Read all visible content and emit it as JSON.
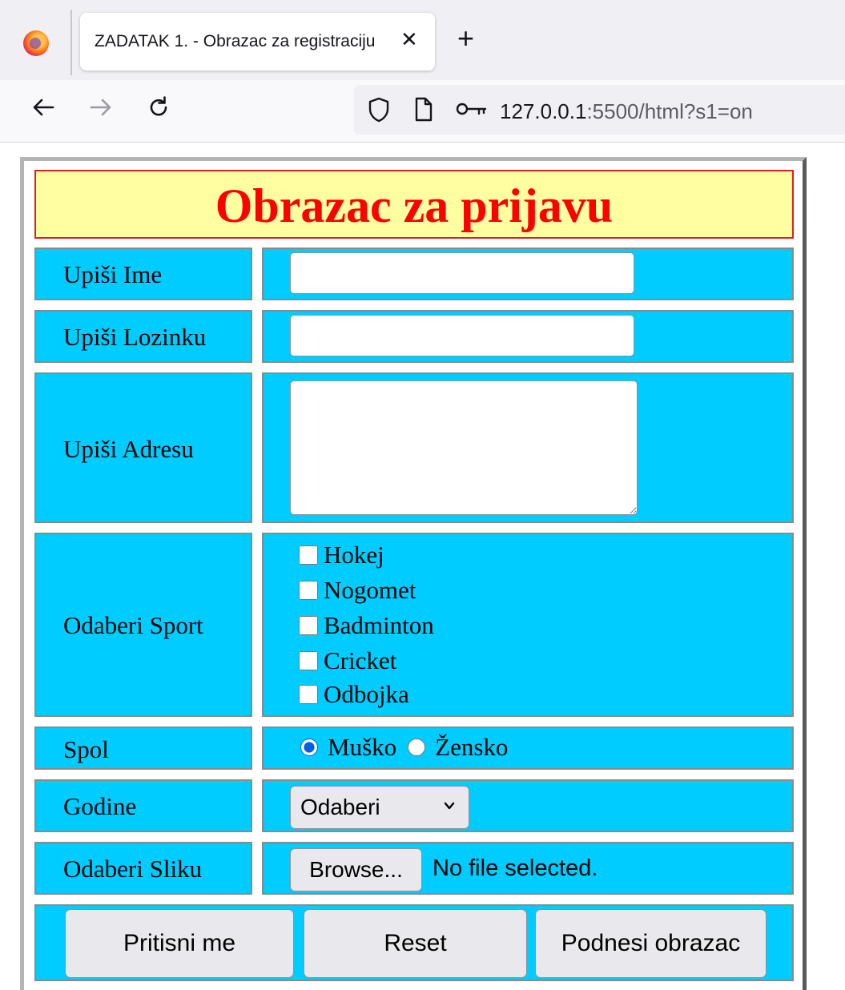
{
  "browser": {
    "tab_title": "ZADATAK 1. - Obrazac za registraciju",
    "tab_close": "✕",
    "new_tab": "+",
    "url_host": "127.0.0.1",
    "url_rest": ":5500/html?s1=on",
    "icons": [
      "firefox-logo",
      "back-arrow",
      "forward-arrow",
      "reload",
      "shield",
      "page",
      "key"
    ]
  },
  "form": {
    "heading": "Obrazac za prijavu",
    "name_label": "Upiši Ime",
    "name_value": "",
    "password_label": "Upiši Lozinku",
    "password_value": "",
    "address_label": "Upiši Adresu",
    "address_value": "",
    "sport_label": "Odaberi Sport",
    "sports": [
      {
        "label": "Hokej",
        "checked": false
      },
      {
        "label": "Nogomet",
        "checked": false
      },
      {
        "label": "Badminton",
        "checked": false
      },
      {
        "label": "Cricket",
        "checked": false
      },
      {
        "label": "Odbojka",
        "checked": false
      }
    ],
    "gender_label": "Spol",
    "genders": [
      {
        "label": "Muško",
        "selected": true
      },
      {
        "label": "Žensko",
        "selected": false
      }
    ],
    "age_label": "Godine",
    "age_selected": "Odaberi",
    "image_label": "Odaberi Sliku",
    "browse_label": "Browse...",
    "no_file_text": "No file selected.",
    "buttons": {
      "press": "Pritisni me",
      "reset": "Reset",
      "submit": "Podnesi obrazac"
    }
  },
  "colors": {
    "cell_background": "#00ccff",
    "heading_background": "#ffffa2",
    "heading_text": "#ff0000"
  }
}
